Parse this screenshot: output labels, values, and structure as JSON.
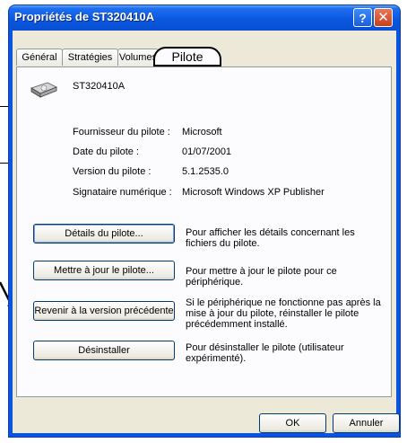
{
  "window": {
    "title": "Propriétés de ST320410A",
    "help_glyph": "?",
    "close_glyph": "✕"
  },
  "tabs": [
    {
      "label": "Général",
      "active": false
    },
    {
      "label": "Stratégies",
      "active": false
    },
    {
      "label": "Volumes",
      "active": false
    },
    {
      "label": "Pilote",
      "active": true
    }
  ],
  "device": {
    "name": "ST320410A",
    "icon": "hard-drive-icon"
  },
  "driver_info": [
    {
      "label": "Fournisseur du pilote :",
      "value": "Microsoft"
    },
    {
      "label": "Date du pilote :",
      "value": "01/07/2001"
    },
    {
      "label": "Version du pilote :",
      "value": "5.1.2535.0"
    },
    {
      "label": "Signataire numérique :",
      "value": "Microsoft Windows XP Publisher"
    }
  ],
  "actions": [
    {
      "button": "Détails du pilote...",
      "description": "Pour afficher les détails concernant les fichiers du pilote."
    },
    {
      "button": "Mettre à jour le pilote...",
      "description": "Pour mettre à jour le pilote pour ce périphérique."
    },
    {
      "button": "Revenir à la version précédente",
      "description": "Si le périphérique ne fonctionne pas après la mise à jour du pilote, réinstaller le pilote précédemment installé."
    },
    {
      "button": "Désinstaller",
      "description": "Pour désinstaller le pilote (utilisateur expérimenté)."
    }
  ],
  "footer": {
    "ok": "OK",
    "cancel": "Annuler"
  },
  "colors": {
    "titlebar": "#0a58e0",
    "dialog_face": "#ece9d8",
    "button_border": "#003c74"
  }
}
